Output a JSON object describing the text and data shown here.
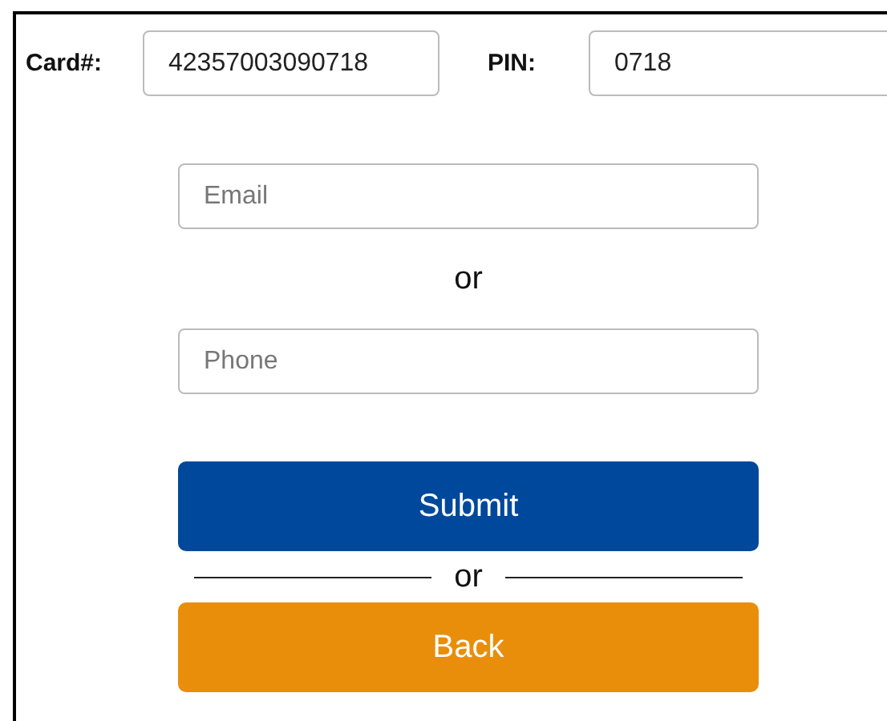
{
  "card": {
    "label": "Card#:",
    "value": "42357003090718"
  },
  "pin": {
    "label": "PIN:",
    "value": "0718"
  },
  "email": {
    "placeholder": "Email"
  },
  "or_text": "or",
  "phone": {
    "placeholder": "Phone"
  },
  "buttons": [
    {
      "label": "Submit",
      "kind": "primary"
    },
    {
      "label": "Back",
      "kind": "secondary"
    }
  ],
  "divider_text": "or"
}
